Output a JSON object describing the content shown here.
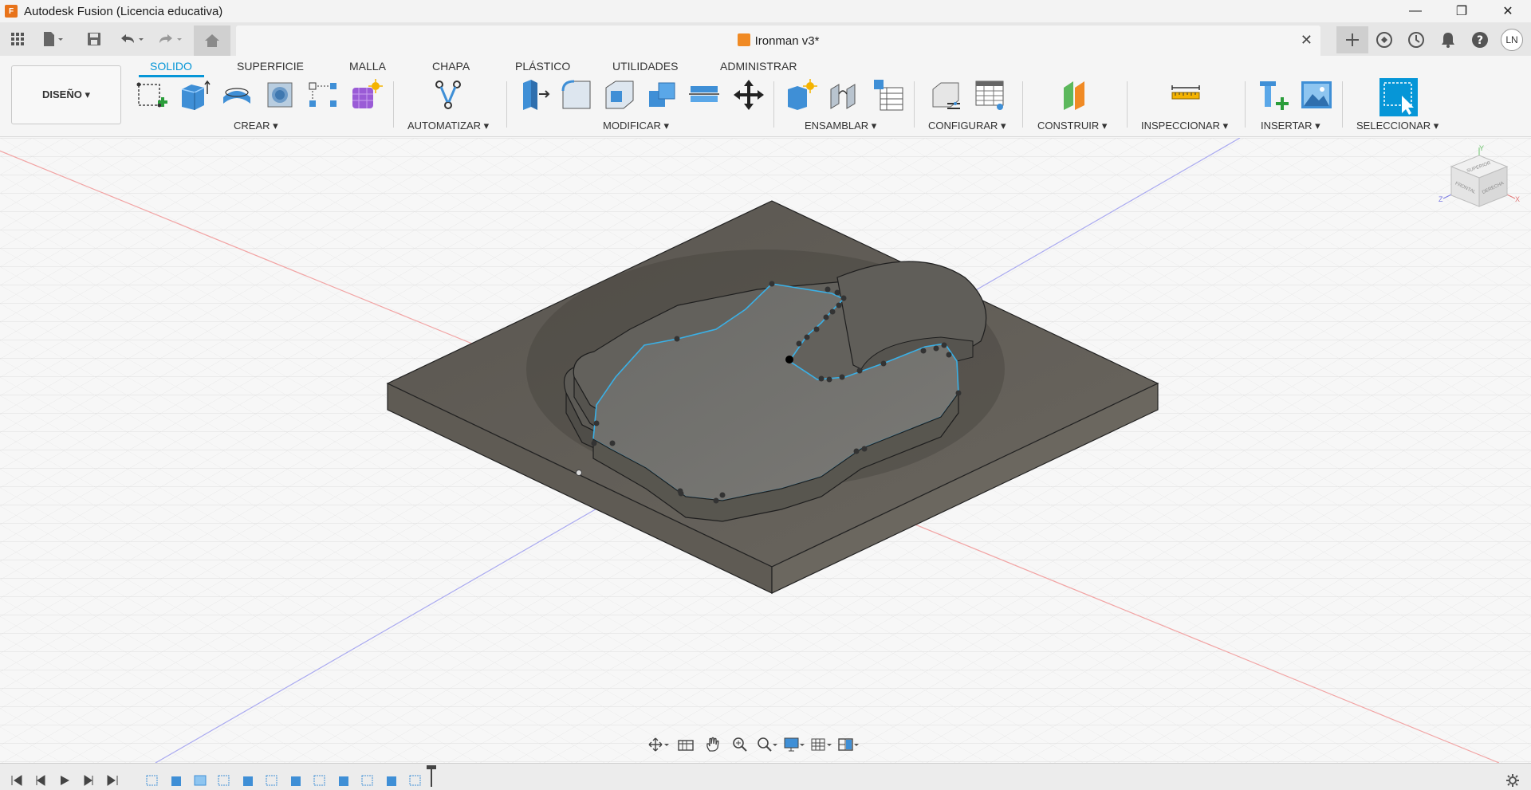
{
  "window": {
    "title": "Autodesk Fusion (Licencia educativa)",
    "logo_text": "F",
    "minimize": "—",
    "restore": "❐",
    "close": "✕"
  },
  "document": {
    "tab_title": "Ironman v3*",
    "close_symbol": "✕"
  },
  "user": {
    "initials": "LN"
  },
  "workspace": {
    "label": "DISEÑO ▾"
  },
  "ribbon": {
    "tabs": [
      {
        "label": "SOLIDO",
        "active": true
      },
      {
        "label": "SUPERFICIE"
      },
      {
        "label": "MALLA"
      },
      {
        "label": "CHAPA"
      },
      {
        "label": "PLÁSTICO"
      },
      {
        "label": "UTILIDADES"
      },
      {
        "label": "ADMINISTRAR"
      }
    ],
    "groups": [
      {
        "label": "CREAR ▾"
      },
      {
        "label": "AUTOMATIZAR ▾"
      },
      {
        "label": "MODIFICAR ▾"
      },
      {
        "label": "ENSAMBLAR ▾"
      },
      {
        "label": "CONFIGURAR ▾"
      },
      {
        "label": "CONSTRUIR ▾"
      },
      {
        "label": "INSPECCIONAR ▾"
      },
      {
        "label": "INSERTAR ▾"
      },
      {
        "label": "SELECCIONAR ▾"
      }
    ]
  },
  "viewcube": {
    "top": "SUPERIOR",
    "front": "FRONTAL",
    "right": "DERECHA",
    "axis_x": "X",
    "axis_y": "Y",
    "axis_z": "Z"
  },
  "colors": {
    "accent": "#0696d7",
    "model_body": "#5f5d57",
    "model_top": "#6b6a66",
    "base_plate": "#59554e",
    "selection_edge": "#3ab0e6"
  }
}
